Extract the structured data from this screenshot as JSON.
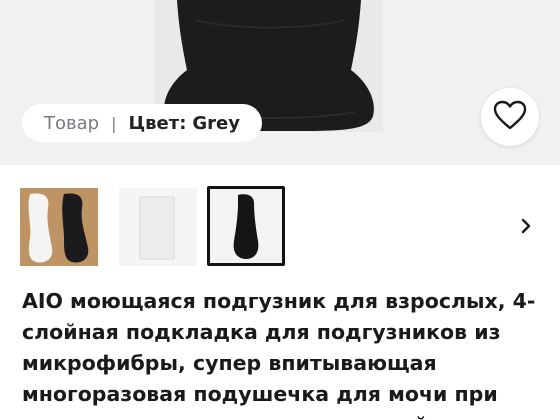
{
  "gallery": {
    "product_label": "Товар",
    "separator": "|",
    "color_label": "Цвет:",
    "color_value": "Grey"
  },
  "icons": {
    "favorite": "heart-outline-icon",
    "next": "chevron-right-icon"
  },
  "thumbnails": [
    {
      "name": "white-and-black-pads",
      "selected": false
    },
    {
      "name": "grey-pad",
      "selected": false
    },
    {
      "name": "black-pad",
      "selected": true
    }
  ],
  "product": {
    "title": "AIO моющаяся подгузник для взрослых, 4-слойная подкладка для подгузников из микрофибры, супер впитывающая многоразовая подушечка для мочи при недержании для пожилых людей"
  },
  "colors": {
    "hero_bg": "#f1f1f3",
    "selected_border": "#111111",
    "text_primary": "#1a1a1a",
    "text_muted": "#7a7a80"
  }
}
